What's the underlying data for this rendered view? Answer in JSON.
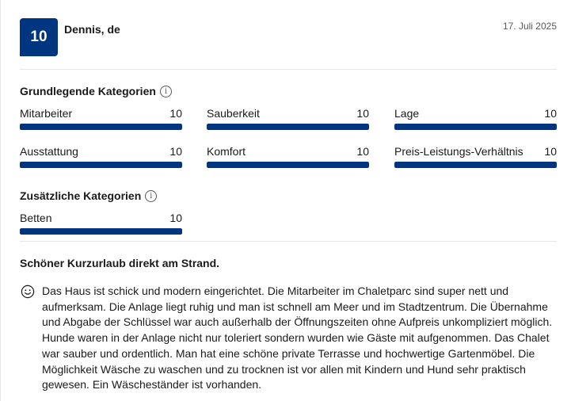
{
  "review": {
    "score": "10",
    "reviewer": "Dennis, de",
    "date": "17. Juli 2025",
    "title": "Schöner Kurzurlaub direkt am Strand.",
    "text": "Das Haus ist schick und modern eingerichtet. Die Mitarbeiter im Chaletparc sind super nett und aufmerksam. Die Anlage liegt ruhig und man ist schnell am Meer und im Stadtzentrum. Die Übernahme und Abgabe der Schlüssel war auch außerhalb der Öffnungszeiten ohne Aufpreis unkompliziert möglich. Hunde waren in der Anlage nicht nur toleriert sondern wurden wie Gäste mit aufgenommen.   Das Chalet war sauber und ordentlich. Man hat eine schöne private Terrasse und hochwertige Gartenmöbel. Die Möglichkeit Wäsche zu waschen und zu trocknen ist vor allen mit Kindern und Hund sehr praktisch gewesen. Ein Wäscheständer ist vorhanden.",
    "positive_icon": "smiley-face-icon"
  },
  "basic_categories": {
    "title": "Grundlegende Kategorien",
    "info_icon": "info-icon",
    "items": [
      {
        "label": "Mitarbeiter",
        "score": "10",
        "fraction": 1.0
      },
      {
        "label": "Sauberkeit",
        "score": "10",
        "fraction": 1.0
      },
      {
        "label": "Lage",
        "score": "10",
        "fraction": 1.0
      },
      {
        "label": "Ausstattung",
        "score": "10",
        "fraction": 1.0
      },
      {
        "label": "Komfort",
        "score": "10",
        "fraction": 1.0
      },
      {
        "label": "Preis-Leistungs-Verhältnis",
        "score": "10",
        "fraction": 1.0
      }
    ]
  },
  "extra_categories": {
    "title": "Zusätzliche Kategorien",
    "info_icon": "info-icon",
    "items": [
      {
        "label": "Betten",
        "score": "10",
        "fraction": 1.0
      }
    ]
  },
  "colors": {
    "brand": "#003580",
    "track": "#e7e7e7"
  }
}
